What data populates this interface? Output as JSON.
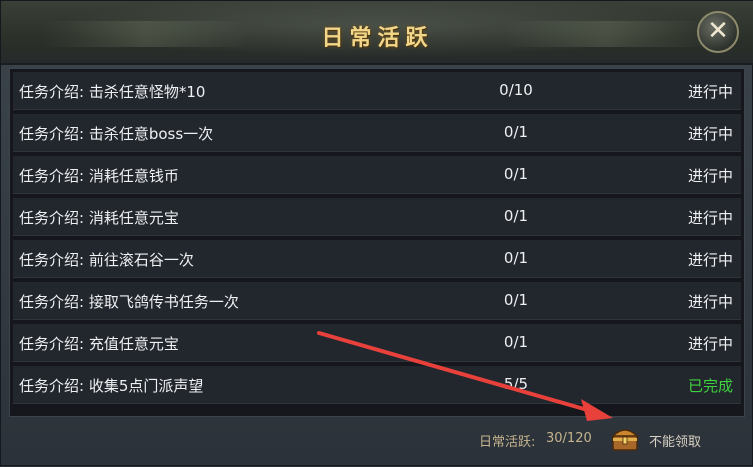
{
  "window": {
    "title": "日常活跃",
    "close_label": "✕"
  },
  "tasks": [
    {
      "description": "任务介绍: 击杀任意怪物*10",
      "progress": "0/10",
      "status": "进行中"
    },
    {
      "description": "任务介绍: 击杀任意boss一次",
      "progress": "0/1",
      "status": "进行中"
    },
    {
      "description": "任务介绍: 消耗任意钱币",
      "progress": "0/1",
      "status": "进行中"
    },
    {
      "description": "任务介绍: 消耗任意元宝",
      "progress": "0/1",
      "status": "进行中"
    },
    {
      "description": "任务介绍: 前往滚石谷一次",
      "progress": "0/1",
      "status": "进行中"
    },
    {
      "description": "任务介绍: 接取飞鸽传书任务一次",
      "progress": "0/1",
      "status": "进行中"
    },
    {
      "description": "任务介绍: 充值任意元宝",
      "progress": "0/1",
      "status": "进行中"
    },
    {
      "description": "任务介绍: 收集5点门派声望",
      "progress": "5/5",
      "status": "已完成"
    }
  ],
  "footer": {
    "activity_label": "日常活跃:",
    "activity_value": "30/120",
    "claim_label": "不能领取"
  },
  "colors": {
    "title": "#f2d78a",
    "in_progress": "#eef0f2",
    "completed": "#3ed33e",
    "annotation_arrow": "#e8413b"
  },
  "icons": {
    "close": "close-icon",
    "chest": "treasure-chest-icon"
  }
}
